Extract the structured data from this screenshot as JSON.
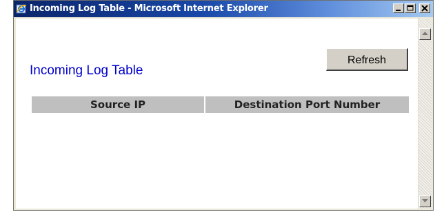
{
  "window": {
    "title": "Incoming Log Table - Microsoft Internet Explorer"
  },
  "page": {
    "heading": "Incoming Log Table",
    "refresh_label": "Refresh"
  },
  "table": {
    "columns": [
      "Source IP",
      "Destination Port Number"
    ]
  },
  "icons": {
    "app": "internet-explorer-icon",
    "minimize": "minimize-icon",
    "maximize": "maximize-icon",
    "close": "close-icon",
    "scroll_up": "arrow-up-icon",
    "scroll_down": "arrow-down-icon"
  },
  "colors": {
    "heading": "#0000cc",
    "titlebar_start": "#0a246a",
    "titlebar_end": "#a6caf0",
    "table_header_bg": "#bfbfbf"
  }
}
